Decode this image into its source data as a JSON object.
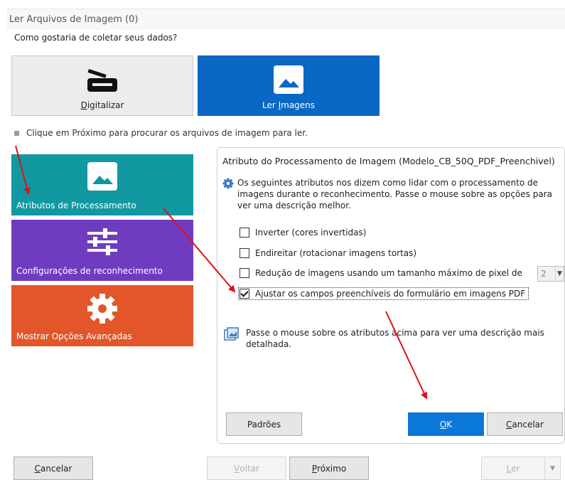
{
  "window": {
    "title": "Ler Arquivos de Imagem (0)"
  },
  "question": "Como gostaria de coletar seus dados?",
  "methods": {
    "scan": {
      "label": "Digitalizar",
      "icon": "scanner-icon",
      "selected": false
    },
    "read": {
      "label": "Ler Imagens",
      "icon": "image-icon",
      "selected": true
    }
  },
  "hint": "Clique em Próximo para procurar os arquivos de imagem para ler.",
  "side_menu": [
    {
      "label": "Atributos de Processamento",
      "icon": "image-icon",
      "color": "#1198a0"
    },
    {
      "label": "Configurações de reconhecimento",
      "icon": "sliders-icon",
      "color": "#6f3cc0"
    },
    {
      "label": "Mostrar Opções Avançadas",
      "icon": "gear-icon",
      "color": "#e2562a"
    }
  ],
  "panel": {
    "title": "Atributo do Processamento de Imagem (Modelo_CB_50Q_PDF_Preenchivel)",
    "info": "Os seguintes atributos nos dizem como lidar com o processamento de imagens durante o reconhecimento. Passe o mouse sobre as opções para ver uma descrição melhor.",
    "options": [
      {
        "label": "Inverter (cores invertidas)",
        "checked": false
      },
      {
        "label": "Endireitar (rotacionar imagens tortas)",
        "checked": false
      },
      {
        "label": "Redução de imagens usando um tamanho máximo de pixel de",
        "checked": false
      },
      {
        "label": "Ajustar os campos preenchíveis do formulário em imagens PDF",
        "checked": true
      }
    ],
    "pixel_value": "2",
    "hover_info": "Passe o mouse sobre os atributos acima para ver uma descrição mais detalhada.",
    "buttons": {
      "defaults": "Padrões",
      "ok": "OK",
      "cancel": "Cancelar"
    }
  },
  "footer": {
    "cancel": "Cancelar",
    "back": "Voltar",
    "next": "Próximo",
    "read": "Ler"
  },
  "colors": {
    "accent": "#0a67c4",
    "ok": "#0a78d7",
    "annotation_arrow": "#e0101a"
  }
}
